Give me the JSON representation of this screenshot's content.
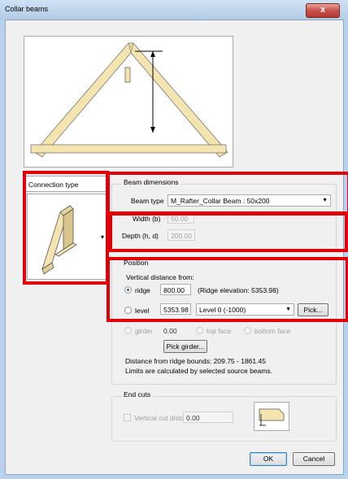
{
  "window": {
    "title": "Collar beams",
    "close_label": "x"
  },
  "connection_type": {
    "label": "Connection type"
  },
  "beam_dimensions": {
    "group_label": "Beam dimensions",
    "beam_type_label": "Beam type",
    "beam_type_value": "M_Rafter_Collar Beam : 50x200",
    "width_label": "Width (b)",
    "width_value": "50.00",
    "depth_label": "Depth (h, d)",
    "depth_value": "200.00"
  },
  "position": {
    "group_label": "Position",
    "vertical_distance_label": "Vertical distance from:",
    "ridge_label": "ridge",
    "ridge_value": "800.00",
    "ridge_elevation": "(Ridge elevation: 5353.98)",
    "level_label": "level",
    "level_value": "5353.98",
    "level_select": "Level 0 (-1000)",
    "pick_label": "Pick...",
    "girder_label": "girder",
    "girder_value": "0.00",
    "top_face_label": "top face",
    "bottom_face_label": "bottom face",
    "pick_girder_label": "Pick girder...",
    "distance_text": "Distance from ridge bounds: 209.75 - 1861.45",
    "limits_text": "Limits are calculated by selected source beams."
  },
  "end_cuts": {
    "group_label": "End cuts",
    "vertical_cut_label": "Vertical cut distance",
    "vertical_cut_value": "0.00"
  },
  "buttons": {
    "ok": "OK",
    "cancel": "Cancel"
  },
  "colors": {
    "highlight": "#e0000a",
    "timber": "#f3e4b0"
  }
}
